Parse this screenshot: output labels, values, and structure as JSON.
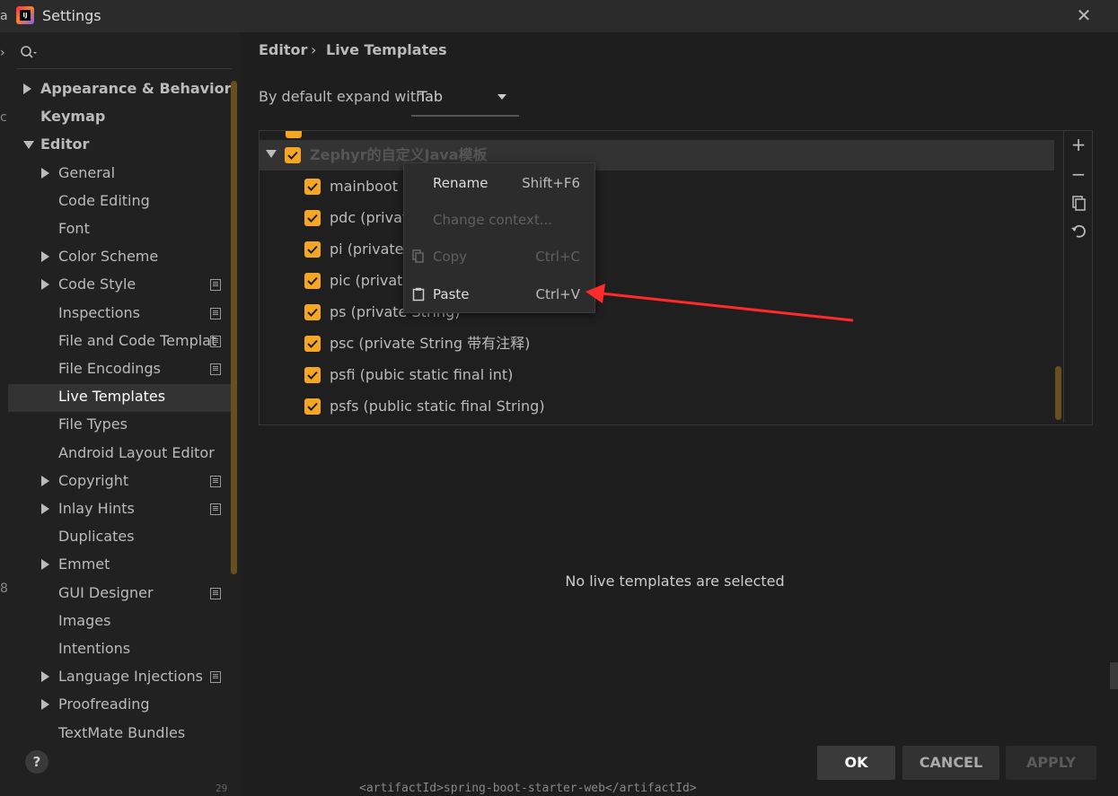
{
  "window": {
    "title": "Settings",
    "edge_text": "al",
    "edge_mid1": "cl",
    "edge_mid2": "8",
    "edge_chevron": "›"
  },
  "sidebar": {
    "items": [
      {
        "label": "Appearance & Behavior",
        "level": 0,
        "bold": true,
        "arrow": "right",
        "proj": false
      },
      {
        "label": "Keymap",
        "level": 0,
        "bold": true,
        "arrow": "none",
        "proj": false
      },
      {
        "label": "Editor",
        "level": 0,
        "bold": true,
        "arrow": "down",
        "proj": false
      },
      {
        "label": "General",
        "level": 1,
        "bold": false,
        "arrow": "right",
        "proj": false
      },
      {
        "label": "Code Editing",
        "level": 1,
        "bold": false,
        "arrow": "none",
        "proj": false
      },
      {
        "label": "Font",
        "level": 1,
        "bold": false,
        "arrow": "none",
        "proj": false
      },
      {
        "label": "Color Scheme",
        "level": 1,
        "bold": false,
        "arrow": "right",
        "proj": false
      },
      {
        "label": "Code Style",
        "level": 1,
        "bold": false,
        "arrow": "right",
        "proj": true
      },
      {
        "label": "Inspections",
        "level": 1,
        "bold": false,
        "arrow": "none",
        "proj": true
      },
      {
        "label": "File and Code Templat",
        "level": 1,
        "bold": false,
        "arrow": "none",
        "proj": true
      },
      {
        "label": "File Encodings",
        "level": 1,
        "bold": false,
        "arrow": "none",
        "proj": true
      },
      {
        "label": "Live Templates",
        "level": 1,
        "bold": false,
        "arrow": "none",
        "proj": false,
        "selected": true
      },
      {
        "label": "File Types",
        "level": 1,
        "bold": false,
        "arrow": "none",
        "proj": false
      },
      {
        "label": "Android Layout Editor",
        "level": 1,
        "bold": false,
        "arrow": "none",
        "proj": false
      },
      {
        "label": "Copyright",
        "level": 1,
        "bold": false,
        "arrow": "right",
        "proj": true
      },
      {
        "label": "Inlay Hints",
        "level": 1,
        "bold": false,
        "arrow": "right",
        "proj": true
      },
      {
        "label": "Duplicates",
        "level": 1,
        "bold": false,
        "arrow": "none",
        "proj": false
      },
      {
        "label": "Emmet",
        "level": 1,
        "bold": false,
        "arrow": "right",
        "proj": false
      },
      {
        "label": "GUI Designer",
        "level": 1,
        "bold": false,
        "arrow": "none",
        "proj": true
      },
      {
        "label": "Images",
        "level": 1,
        "bold": false,
        "arrow": "none",
        "proj": false
      },
      {
        "label": "Intentions",
        "level": 1,
        "bold": false,
        "arrow": "none",
        "proj": false
      },
      {
        "label": "Language Injections",
        "level": 1,
        "bold": false,
        "arrow": "right",
        "proj": true
      },
      {
        "label": "Proofreading",
        "level": 1,
        "bold": false,
        "arrow": "right",
        "proj": false
      },
      {
        "label": "TextMate Bundles",
        "level": 1,
        "bold": false,
        "arrow": "none",
        "proj": false
      }
    ],
    "help_label": "?"
  },
  "breadcrumb": {
    "parent": "Editor",
    "separator": "›",
    "current": "Live Templates"
  },
  "expand": {
    "label": "By default expand with",
    "value": "Tab"
  },
  "templates": {
    "group": "Zephyr的自定义Java模板",
    "items": [
      "mainboot (s",
      "pdc (private",
      "pi (private",
      "pic (private",
      "ps (private String)",
      "psc (private String 带有注释)",
      "psfi (pubic static final int)",
      "psfs (public static final String)"
    ]
  },
  "toolbar": {
    "add": "+",
    "remove": "−"
  },
  "context_menu": {
    "items": [
      {
        "label": "Rename",
        "shortcut": "Shift+F6",
        "disabled": false,
        "icon": "none"
      },
      {
        "label": "Change context...",
        "shortcut": "",
        "disabled": true,
        "icon": "none"
      },
      {
        "label": "Copy",
        "shortcut": "Ctrl+C",
        "disabled": true,
        "icon": "copy-icon"
      },
      {
        "label": "Paste",
        "shortcut": "Ctrl+V",
        "disabled": false,
        "icon": "paste-icon"
      }
    ]
  },
  "empty_message": "No live templates are selected",
  "buttons": {
    "ok": "OK",
    "cancel": "CANCEL",
    "apply": "APPLY"
  },
  "background": {
    "line_number": "29",
    "code": "<artifactId>spring-boot-starter-web</artifactId>"
  },
  "colors": {
    "accent_checkbox": "#f5a623",
    "annotation_arrow": "#ff2a2a"
  }
}
